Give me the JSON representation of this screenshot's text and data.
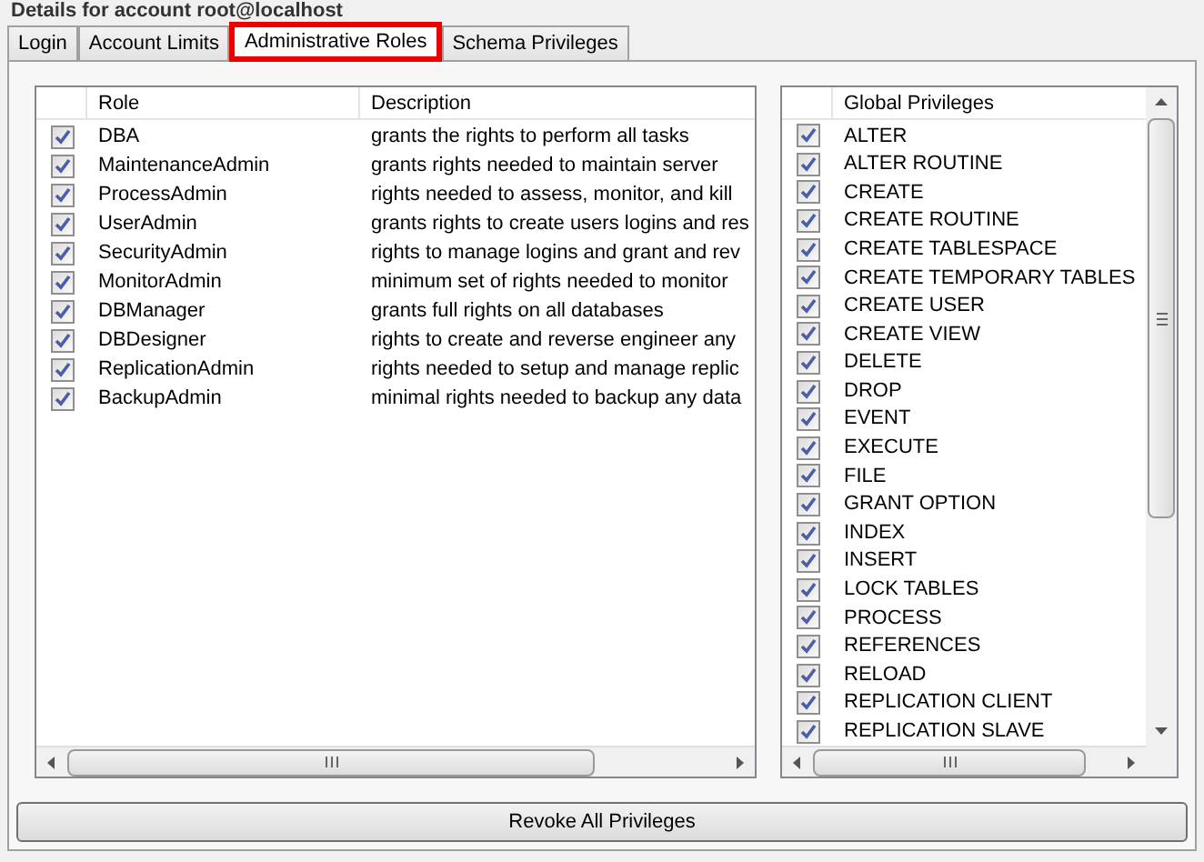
{
  "header": {
    "title": "Details for account root@localhost"
  },
  "tabs": [
    {
      "label": "Login",
      "selected": false
    },
    {
      "label": "Account Limits",
      "selected": false
    },
    {
      "label": "Administrative Roles",
      "selected": true
    },
    {
      "label": "Schema Privileges",
      "selected": false
    }
  ],
  "roles_table": {
    "columns": [
      "Role",
      "Description"
    ],
    "rows": [
      {
        "checked": true,
        "role": "DBA",
        "description": "grants the rights to perform all tasks"
      },
      {
        "checked": true,
        "role": "MaintenanceAdmin",
        "description": "grants rights needed to maintain server"
      },
      {
        "checked": true,
        "role": "ProcessAdmin",
        "description": "rights needed to assess, monitor, and kill"
      },
      {
        "checked": true,
        "role": "UserAdmin",
        "description": "grants rights to create users logins and res"
      },
      {
        "checked": true,
        "role": "SecurityAdmin",
        "description": "rights to manage logins and grant and rev"
      },
      {
        "checked": true,
        "role": "MonitorAdmin",
        "description": "minimum set of rights needed to monitor"
      },
      {
        "checked": true,
        "role": "DBManager",
        "description": "grants full rights on all databases"
      },
      {
        "checked": true,
        "role": "DBDesigner",
        "description": "rights to create and reverse engineer any"
      },
      {
        "checked": true,
        "role": "ReplicationAdmin",
        "description": "rights needed to setup and manage replic"
      },
      {
        "checked": true,
        "role": "BackupAdmin",
        "description": "minimal rights needed to backup any data"
      }
    ]
  },
  "privileges_table": {
    "columns": [
      "Global Privileges"
    ],
    "rows": [
      {
        "checked": true,
        "name": "ALTER"
      },
      {
        "checked": true,
        "name": "ALTER ROUTINE"
      },
      {
        "checked": true,
        "name": "CREATE"
      },
      {
        "checked": true,
        "name": "CREATE ROUTINE"
      },
      {
        "checked": true,
        "name": "CREATE TABLESPACE"
      },
      {
        "checked": true,
        "name": "CREATE TEMPORARY TABLES"
      },
      {
        "checked": true,
        "name": "CREATE USER"
      },
      {
        "checked": true,
        "name": "CREATE VIEW"
      },
      {
        "checked": true,
        "name": "DELETE"
      },
      {
        "checked": true,
        "name": "DROP"
      },
      {
        "checked": true,
        "name": "EVENT"
      },
      {
        "checked": true,
        "name": "EXECUTE"
      },
      {
        "checked": true,
        "name": "FILE"
      },
      {
        "checked": true,
        "name": "GRANT OPTION"
      },
      {
        "checked": true,
        "name": "INDEX"
      },
      {
        "checked": true,
        "name": "INSERT"
      },
      {
        "checked": true,
        "name": "LOCK TABLES"
      },
      {
        "checked": true,
        "name": "PROCESS"
      },
      {
        "checked": true,
        "name": "REFERENCES"
      },
      {
        "checked": true,
        "name": "RELOAD"
      },
      {
        "checked": true,
        "name": "REPLICATION CLIENT"
      },
      {
        "checked": true,
        "name": "REPLICATION SLAVE"
      }
    ]
  },
  "buttons": [
    "Revoke All Privileges"
  ]
}
